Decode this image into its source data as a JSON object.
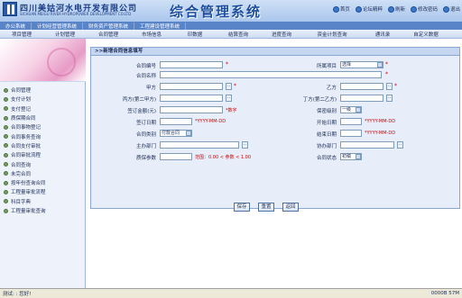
{
  "header": {
    "company_cn": "四川美姑河水电开发有限公司",
    "company_en": "SICHUAN MEIGU RIVER HYDROPOWER DEVELOPMENT CO.LTD",
    "system_title": "综合管理系统",
    "links": [
      "首页",
      "论坛精粹",
      "刷新",
      "修改密码",
      "退出"
    ]
  },
  "nav_systems": [
    "办公系统",
    "计划经营管理系统",
    "财务资产管理系统",
    "工程建设管理系统"
  ],
  "nav_modules": [
    "项目管理",
    "计划管理",
    "合同管理",
    "市场信息",
    "印数据",
    "结算查询",
    "进度查询",
    "资金计划查询",
    "通讯录",
    "自定义数据"
  ],
  "sidebar": {
    "items": [
      "合同管理",
      "支付计划",
      "支付登记",
      "质保期合同",
      "合同事物登记",
      "合同事务查询",
      "合同支付审批",
      "合同审批流程",
      "合同查询",
      "未完合同",
      "按年份查询合同",
      "工程量审批流程",
      "科目字典",
      "工程量审批查询"
    ]
  },
  "form": {
    "title": ">>新增合同信息填写",
    "labels": {
      "contract_no": "合同编号",
      "project": "所属项目",
      "contract_name": "合同名称",
      "party_a": "甲方",
      "party_b": "乙方",
      "party_c": "丙方(第二甲方)",
      "party_d": "丁方(第二乙方)",
      "amount": "签订金额(元)",
      "secret": "保密级别",
      "sign_date": "签订日期",
      "start_date": "开始日期",
      "contract_type": "合同类别",
      "end_date": "结束日期",
      "main_dept": "主办部门",
      "assist_dept": "协办部门",
      "warranty": "质保参数",
      "status": "合同状态"
    },
    "values": {
      "project": "选择",
      "secret": "一级",
      "contract_type": "付款合同",
      "status": "初稿"
    },
    "hints": {
      "amount": "*数字",
      "date": "*YYYY-MM-DD",
      "warranty": "范围：0.00 < 参数 < 1.00"
    },
    "buttons": {
      "save": "保存",
      "reset": "重置",
      "back": "返回"
    }
  },
  "status_bar": {
    "text": "测试: : 您好!",
    "right": "0000B 57M"
  }
}
